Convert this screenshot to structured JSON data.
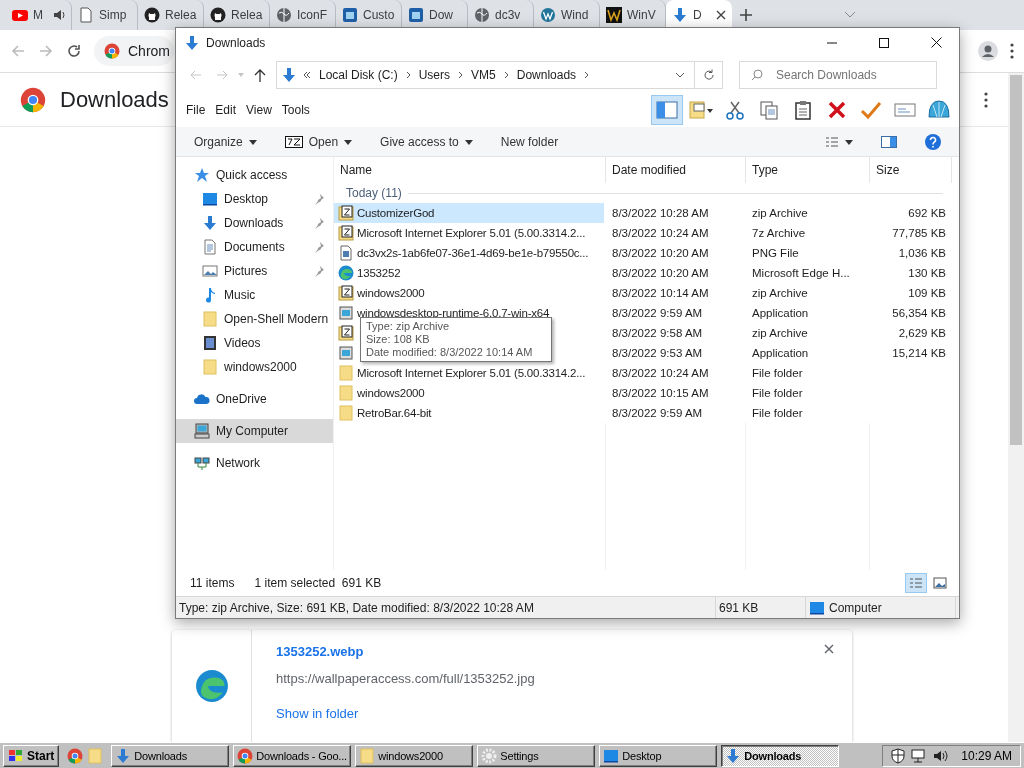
{
  "browser": {
    "tabs": [
      {
        "label": "M",
        "kind": "youtube",
        "audio": true,
        "selected": false
      },
      {
        "label": "Simp",
        "kind": "page",
        "audio": false,
        "selected": false
      },
      {
        "label": "Relea",
        "kind": "github",
        "audio": false,
        "selected": false
      },
      {
        "label": "Relea",
        "kind": "github",
        "audio": false,
        "selected": false
      },
      {
        "label": "IconF",
        "kind": "globe",
        "audio": false,
        "selected": false
      },
      {
        "label": "Custo",
        "kind": "app",
        "audio": false,
        "selected": false
      },
      {
        "label": "Dow",
        "kind": "app",
        "audio": false,
        "selected": false
      },
      {
        "label": "dc3v",
        "kind": "globe",
        "audio": false,
        "selected": false
      },
      {
        "label": "Wind",
        "kind": "wordpress",
        "audio": false,
        "selected": false
      },
      {
        "label": "WinV",
        "kind": "wlogo",
        "audio": false,
        "selected": false
      },
      {
        "label": "D",
        "kind": "download",
        "audio": false,
        "selected": true
      }
    ],
    "address": "Chrom",
    "page_title": "Downloads",
    "download": {
      "file": "1353252.webp",
      "url": "https://wallpaperaccess.com/full/1353252.jpg",
      "action": "Show in folder"
    }
  },
  "explorer": {
    "title": "Downloads",
    "breadcrumbs": [
      "Local Disk (C:)",
      "Users",
      "VM5",
      "Downloads"
    ],
    "search": {
      "placeholder": "Search Downloads"
    },
    "menu": [
      "File",
      "Edit",
      "View",
      "Tools"
    ],
    "toolbar": [
      {
        "kind": "pane",
        "selected": true
      },
      {
        "kind": "properties",
        "selected": false
      },
      {
        "kind": "cut",
        "selected": false
      },
      {
        "kind": "copy",
        "selected": false
      },
      {
        "kind": "paste",
        "selected": false
      },
      {
        "kind": "delete",
        "selected": false
      },
      {
        "kind": "check",
        "selected": false
      },
      {
        "kind": "mail",
        "selected": false
      },
      {
        "kind": "shell",
        "selected": false
      }
    ],
    "commands": [
      {
        "label": "Organize",
        "kind": "plain",
        "dropdown": true
      },
      {
        "label": "Open",
        "kind": "archive",
        "dropdown": true
      },
      {
        "label": "Give access to",
        "kind": "plain",
        "dropdown": true
      },
      {
        "label": "New folder",
        "kind": "plain",
        "dropdown": false
      }
    ],
    "nav": [
      {
        "label": "Quick access",
        "kind": "star",
        "selected": false,
        "children": [
          {
            "label": "Desktop",
            "kind": "desktop",
            "pinned": true,
            "selected": false
          },
          {
            "label": "Downloads",
            "kind": "download",
            "pinned": true,
            "selected": false
          },
          {
            "label": "Documents",
            "kind": "document",
            "pinned": true,
            "selected": false
          },
          {
            "label": "Pictures",
            "kind": "pictures",
            "pinned": true,
            "selected": false
          },
          {
            "label": "Music",
            "kind": "music",
            "pinned": false,
            "selected": false
          },
          {
            "label": "Open-Shell Modern",
            "kind": "folder",
            "pinned": false,
            "selected": false
          },
          {
            "label": "Videos",
            "kind": "videos",
            "pinned": false,
            "selected": false
          },
          {
            "label": "windows2000",
            "kind": "folder",
            "pinned": false,
            "selected": false
          }
        ]
      },
      {
        "label": "OneDrive",
        "kind": "cloud",
        "selected": false
      },
      {
        "label": "My Computer",
        "kind": "computer",
        "selected": true
      },
      {
        "label": "Network",
        "kind": "network",
        "selected": false
      }
    ],
    "columns": [
      "Name",
      "Date modified",
      "Type",
      "Size"
    ],
    "group": "Today (11)",
    "files": [
      {
        "name": "CustomizerGod",
        "kind": "zip",
        "date": "8/3/2022 10:28 AM",
        "type": "zip Archive",
        "size": "692 KB",
        "selected": true
      },
      {
        "name": "Microsoft Internet Explorer 5.01 (5.00.3314.2...",
        "kind": "zip",
        "date": "8/3/2022 10:24 AM",
        "type": "7z Archive",
        "size": "77,785 KB",
        "selected": false
      },
      {
        "name": "dc3vx2s-1ab6fe07-36e1-4d69-be1e-b79550c...",
        "kind": "image",
        "date": "8/3/2022 10:20 AM",
        "type": "PNG File",
        "size": "1,036 KB",
        "selected": false
      },
      {
        "name": "1353252",
        "kind": "edge",
        "date": "8/3/2022 10:20 AM",
        "type": "Microsoft Edge H...",
        "size": "130 KB",
        "selected": false
      },
      {
        "name": "windows2000",
        "kind": "zip",
        "date": "8/3/2022 10:14 AM",
        "type": "zip Archive",
        "size": "109 KB",
        "selected": false
      },
      {
        "name": "windowsdesktop-runtime-6.0.7-win-x64",
        "kind": "app",
        "date": "8/3/2022 9:59 AM",
        "type": "Application",
        "size": "56,354 KB",
        "selected": false
      },
      {
        "kind": "zip",
        "date": "8/3/2022 9:58 AM",
        "type": "zip Archive",
        "size": "2,629 KB",
        "selected": false
      },
      {
        "kind": "app",
        "date": "8/3/2022 9:53 AM",
        "type": "Application",
        "size": "15,214 KB",
        "selected": false
      },
      {
        "name": "Microsoft Internet Explorer 5.01 (5.00.3314.2...",
        "kind": "folder",
        "date": "8/3/2022 10:24 AM",
        "type": "File folder",
        "selected": false
      },
      {
        "name": "windows2000",
        "kind": "folder",
        "date": "8/3/2022 10:15 AM",
        "type": "File folder",
        "selected": false
      },
      {
        "name": "RetroBar.64-bit",
        "kind": "folder",
        "date": "8/3/2022 9:59 AM",
        "type": "File folder",
        "selected": false
      }
    ],
    "tooltip": [
      "Type: zip Archive",
      "Size: 108 KB",
      "Date modified: 8/3/2022 10:14 AM"
    ],
    "item_count": "11 items",
    "selection": "1 item selected  691 KB",
    "views": [
      {
        "kind": "details",
        "selected": true
      },
      {
        "kind": "tiles",
        "selected": false
      }
    ],
    "status": {
      "details": "Type: zip Archive, Size: 691 KB, Date modified: 8/3/2022 10:28 AM",
      "size": "691 KB",
      "zone": "Computer"
    }
  },
  "taskbar": {
    "start": "Start",
    "buttons": [
      {
        "label": "Downloads",
        "kind": "download",
        "selected": false
      },
      {
        "label": "Downloads - Goo...",
        "kind": "chrome",
        "selected": false
      },
      {
        "label": "windows2000",
        "kind": "folder",
        "selected": false
      },
      {
        "label": "Settings",
        "kind": "gear",
        "selected": false
      },
      {
        "label": "Desktop",
        "kind": "desktop",
        "selected": false
      },
      {
        "label": "Downloads",
        "kind": "download",
        "selected": true
      }
    ],
    "clock": "10:29 AM"
  }
}
